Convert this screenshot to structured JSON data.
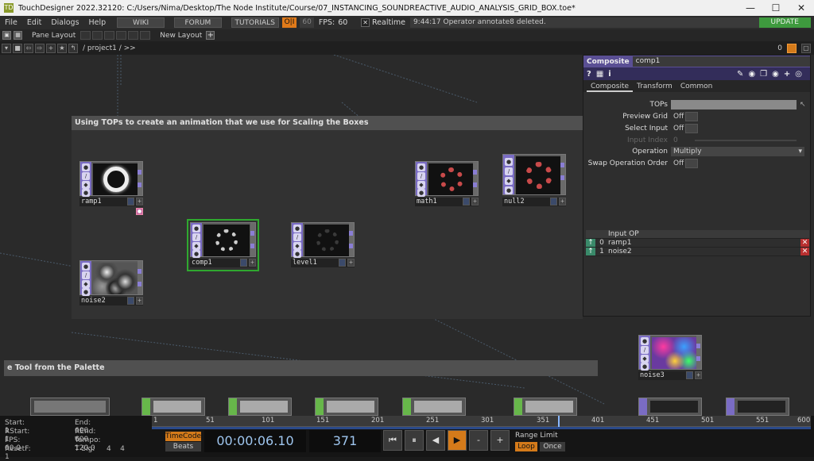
{
  "window": {
    "title": "TouchDesigner 2022.32120: C:/Users/Nima/Desktop/The Node Institute/Course/07_INSTANCING_SOUNDREACTIVE_AUDIO_ANALYSIS_GRID_BOX.toe*",
    "app_icon": "TD"
  },
  "menu": {
    "items": [
      "File",
      "Edit",
      "Dialogs",
      "Help"
    ],
    "wiki": "WIKI",
    "forum": "FORUM",
    "tutorials": "TUTORIALS",
    "perf": "O|I",
    "fps_box": "60",
    "fps_label": "FPS:",
    "fps_value": "60",
    "realtime": "Realtime",
    "message": "9:44:17 Operator annotate8 deleted.",
    "update": "UPDATE"
  },
  "panebar": {
    "pane_layout": "Pane Layout",
    "new_layout": "New Layout",
    "plus": "+"
  },
  "pathbar": {
    "path": "/ project1 / >>",
    "page_num": "0"
  },
  "network": {
    "annot1": "Using TOPs to create an animation that we use for Scaling the Boxes",
    "annot2": "e Tool from the Palette",
    "ops": {
      "ramp1": "ramp1",
      "noise2": "noise2",
      "comp1": "comp1",
      "level1": "level1",
      "math1": "math1",
      "null2": "null2",
      "noise3": "noise3"
    }
  },
  "panel": {
    "type": "Composite",
    "name": "comp1",
    "tabs": [
      "Composite",
      "Transform",
      "Common"
    ],
    "params": {
      "tops_label": "TOPs",
      "preview_grid_label": "Preview Grid",
      "preview_grid_value": "Off",
      "select_input_label": "Select Input",
      "select_input_value": "Off",
      "input_index_label": "Input Index",
      "input_index_value": "0",
      "operation_label": "Operation",
      "operation_value": "Multiply",
      "swap_label": "Swap Operation Order",
      "swap_value": "Off"
    },
    "input_table": {
      "header": "Input OP",
      "rows": [
        {
          "index": "0",
          "name": "ramp1"
        },
        {
          "index": "1",
          "name": "noise2"
        }
      ]
    }
  },
  "timeline": {
    "start_label": "Start:",
    "start_value": "1",
    "rstart_label": "RStart:",
    "rstart_value": "1",
    "fps_label": "FPS:",
    "fps_value": "60.0",
    "resetf_label": "ResetF:",
    "resetf_value": "1",
    "end_label": "End:",
    "end_value": "600",
    "rend_label": "REnd:",
    "rend_value": "600",
    "tempo_label": "Tempo:",
    "tempo_value": "120.0",
    "tsig_label": "T Sig:",
    "tsig_value": "4    4",
    "ruler_labels": [
      "1",
      "51",
      "101",
      "151",
      "201",
      "251",
      "301",
      "351",
      "401",
      "451",
      "501",
      "551",
      "600"
    ],
    "timecode_btn": "TimeCode",
    "beats_btn": "Beats",
    "timecode": "00:00:06.10",
    "frame": "371",
    "range_limit": "Range Limit",
    "loop": "Loop",
    "once": "Once",
    "controls": [
      "⏮",
      "⏸",
      "◀",
      "▶",
      "-",
      "+"
    ]
  }
}
